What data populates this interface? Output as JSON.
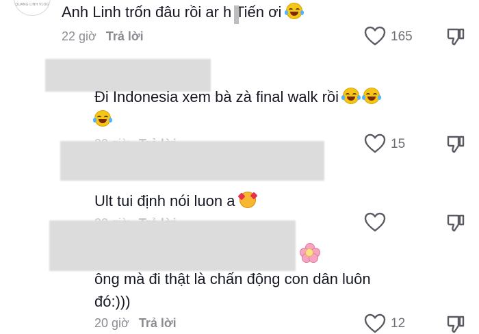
{
  "channel": {
    "caption": "QUANG LINH VLOG"
  },
  "colors": {
    "text": "#161823",
    "meta": "#8a8b91",
    "redaction": "#dcdcdc"
  },
  "comments": [
    {
      "text": "Anh Linh trốn đâu rồi ar h Tiến ơi",
      "trailing_emoji": [
        "laughing-with-tears"
      ],
      "time": "22 giờ",
      "reply": "Trả lời",
      "likes": "165"
    },
    {
      "text_line1": "Đi Indonesia xem bà zà final walk rồi",
      "trailing_emoji": [
        "laughing-with-tears",
        "laughing-with-tears",
        "laughing-with-tears"
      ],
      "time": "20 giờ",
      "reply": "Trả lời",
      "likes": "15"
    },
    {
      "text": "Ult tui định nói luon a",
      "trailing_emoji": [
        "smiling-face-with-hearts"
      ],
      "time": "20 giờ",
      "reply": "Trả lời",
      "likes": ""
    },
    {
      "leading_emoji": [
        "cherry-blossom"
      ],
      "text_line1": "ông mà đi thật là chấn động con dân luôn",
      "text_line2": "đó:)))",
      "time": "20 giờ",
      "reply": "Trả lời",
      "likes": "12"
    }
  ],
  "icons": {
    "like": "heart-outline-icon",
    "dislike": "thumbs-down-icon"
  }
}
